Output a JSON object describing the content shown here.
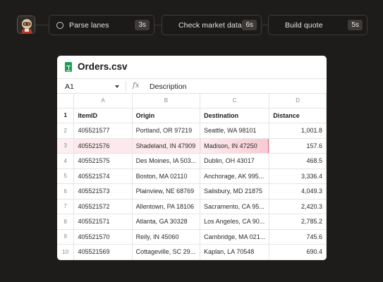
{
  "pipeline": {
    "steps": [
      {
        "label": "Parse lanes",
        "duration": "3s",
        "state": "running"
      },
      {
        "label": "Check market data",
        "duration": "6s",
        "state": "pending"
      },
      {
        "label": "Build quote",
        "duration": "5s",
        "state": "pending"
      }
    ]
  },
  "sheet": {
    "file_name": "Orders.csv",
    "cell_ref": "A1",
    "fx_symbol": "fx",
    "formula_value": "Description",
    "columns": [
      "A",
      "B",
      "C",
      "D"
    ],
    "header_row": {
      "row": "1",
      "cells": [
        "ItemID",
        "Origin",
        "Destination",
        "Distance"
      ]
    },
    "rows": [
      {
        "row": "2",
        "cells": [
          "405521577",
          "Portland, OR 97219",
          "Seattle, WA 98101",
          "1,001.8"
        ]
      },
      {
        "row": "3",
        "cells": [
          "405521576",
          "Shadeland, IN 47909",
          "Madison, IN 47250",
          "157.6"
        ],
        "highlighted": true
      },
      {
        "row": "4",
        "cells": [
          "405521575",
          "Des Moines, IA 503...",
          "Dublin, OH 43017",
          "468.5"
        ]
      },
      {
        "row": "5",
        "cells": [
          "405521574",
          "Boston, MA 02110",
          "Anchorage, AK 995...",
          "3,336.4"
        ]
      },
      {
        "row": "6",
        "cells": [
          "405521573",
          "Plainview, NE 68769",
          "Salisbury, MD 21875",
          "4,049.3"
        ]
      },
      {
        "row": "7",
        "cells": [
          "405521572",
          "Allentown, PA 18106",
          "Sacramento, CA 95...",
          "2,420.3"
        ]
      },
      {
        "row": "8",
        "cells": [
          "405521571",
          "Atlanta, GA 30328",
          "Los Angeles, CA 90...",
          "2,785.2"
        ]
      },
      {
        "row": "9",
        "cells": [
          "405521570",
          "Reily, IN 45060",
          "Cambridge, MA 021...",
          "745.6"
        ]
      },
      {
        "row": "10",
        "cells": [
          "405521569",
          "Cottageville, SC 29...",
          "Kaplan, LA 70548",
          "690.4"
        ]
      }
    ]
  },
  "colors": {
    "background": "#1e1c1b",
    "highlight": "#fde9ec",
    "highlight_edge": "#e26a86",
    "file_icon": "#1e9e54"
  }
}
